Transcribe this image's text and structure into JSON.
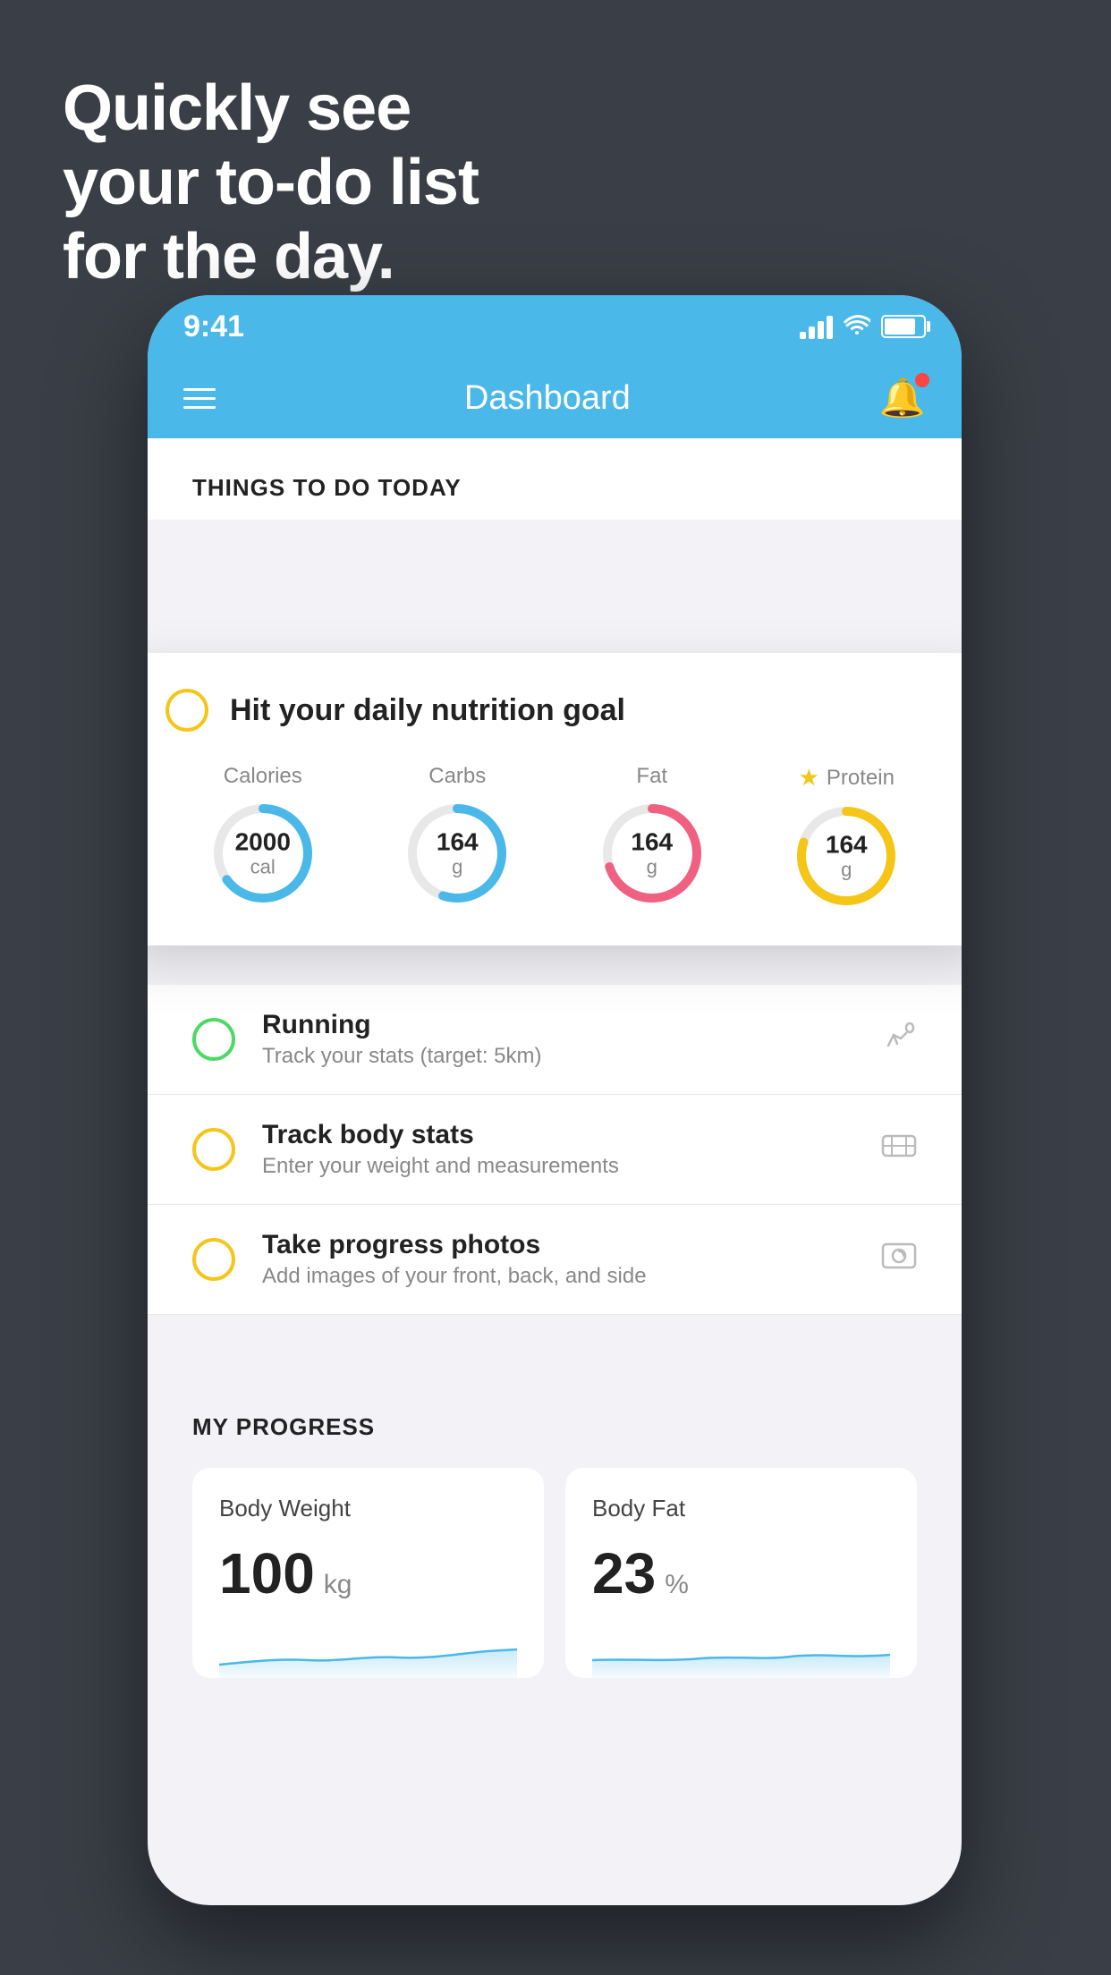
{
  "hero": {
    "line1": "Quickly see",
    "line2": "your to-do list",
    "line3": "for the day."
  },
  "status_bar": {
    "time": "9:41"
  },
  "header": {
    "title": "Dashboard"
  },
  "things_section": {
    "title": "THINGS TO DO TODAY"
  },
  "floating_card": {
    "circle_color": "yellow",
    "title": "Hit your daily nutrition goal",
    "nutrition": [
      {
        "label": "Calories",
        "value": "2000",
        "unit": "cal",
        "color": "blue",
        "percent": 65
      },
      {
        "label": "Carbs",
        "value": "164",
        "unit": "g",
        "color": "blue",
        "percent": 55
      },
      {
        "label": "Fat",
        "value": "164",
        "unit": "g",
        "color": "pink",
        "percent": 70
      },
      {
        "label": "Protein",
        "value": "164",
        "unit": "g",
        "color": "yellow",
        "percent": 80,
        "starred": true
      }
    ]
  },
  "todo_items": [
    {
      "id": "running",
      "name": "Running",
      "sub": "Track your stats (target: 5km)",
      "circle_color": "green",
      "icon": "👟"
    },
    {
      "id": "track-body-stats",
      "name": "Track body stats",
      "sub": "Enter your weight and measurements",
      "circle_color": "yellow",
      "icon": "⚖️"
    },
    {
      "id": "progress-photos",
      "name": "Take progress photos",
      "sub": "Add images of your front, back, and side",
      "circle_color": "yellow",
      "icon": "👤"
    }
  ],
  "my_progress": {
    "title": "MY PROGRESS",
    "cards": [
      {
        "id": "body-weight",
        "title": "Body Weight",
        "value": "100",
        "unit": "kg"
      },
      {
        "id": "body-fat",
        "title": "Body Fat",
        "value": "23",
        "unit": "%"
      }
    ]
  },
  "colors": {
    "header_bg": "#4ab8e8",
    "background": "#3a3f47",
    "white": "#ffffff"
  }
}
